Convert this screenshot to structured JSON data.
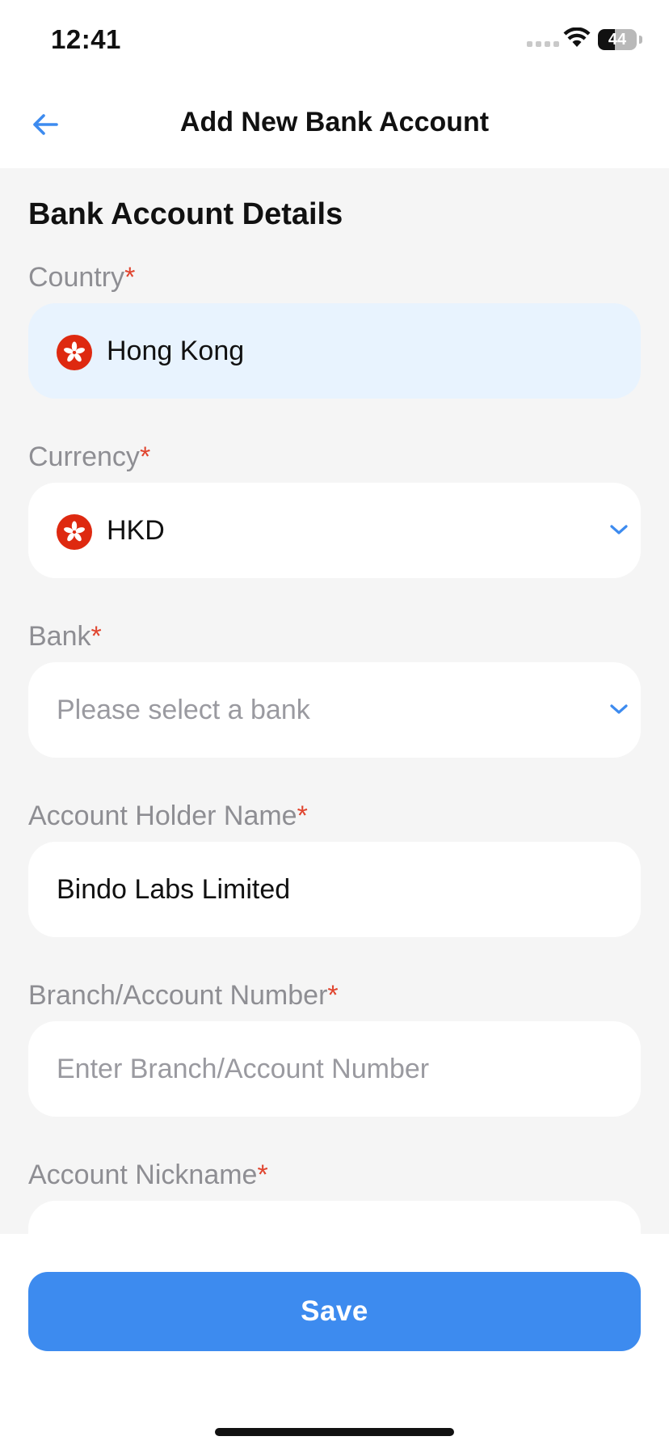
{
  "status_bar": {
    "time": "12:41",
    "battery_level": 44,
    "battery_label": "44"
  },
  "nav": {
    "title": "Add New Bank Account",
    "back_icon": "arrow-left-icon"
  },
  "form": {
    "section_title": "Bank Account Details",
    "required_marker": "*",
    "country": {
      "label": "Country",
      "value": "Hong Kong",
      "flag_icon": "hong-kong-flag-icon",
      "disabled": true
    },
    "currency": {
      "label": "Currency",
      "value": "HKD",
      "flag_icon": "hong-kong-flag-icon",
      "dropdown_icon": "chevron-down-icon"
    },
    "bank": {
      "label": "Bank",
      "placeholder": "Please select a bank",
      "dropdown_icon": "chevron-down-icon"
    },
    "account_holder": {
      "label": "Account Holder Name",
      "value": "Bindo Labs Limited"
    },
    "branch_account": {
      "label": "Branch/Account Number",
      "placeholder": "Enter Branch/Account Number"
    },
    "nickname": {
      "label": "Account Nickname"
    }
  },
  "actions": {
    "save_label": "Save"
  },
  "colors": {
    "accent": "#3d8bef",
    "required": "#e0452f",
    "label_gray": "#8e8e93",
    "disabled_field": "#e8f3fe",
    "flag_red": "#de2910",
    "background": "#f5f5f5"
  }
}
